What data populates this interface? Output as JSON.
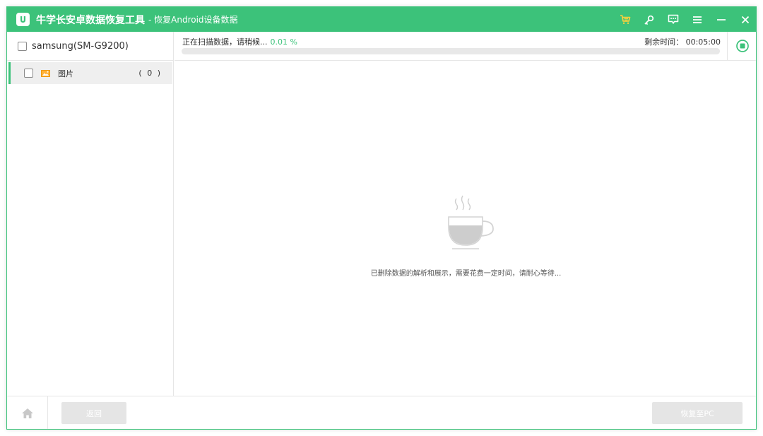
{
  "app": {
    "title": "牛学长安卓数据恢复工具",
    "subtitle": "- 恢复Android设备数据",
    "accent_color": "#3cc27a",
    "logo_letter": "U"
  },
  "titlebar_icons": [
    "cart-icon",
    "key-icon",
    "feedback-icon",
    "menu-icon",
    "minimize-icon",
    "close-icon"
  ],
  "device": {
    "name": "samsung(SM-G9200)"
  },
  "categories": [
    {
      "label": "图片",
      "count": "( 0 )",
      "icon": "image-icon"
    }
  ],
  "scan": {
    "status": "正在扫描数据，请稍候...",
    "percent_text": "0.01 %",
    "progress": 0.0001,
    "remaining_label": "剩余时间：",
    "remaining_time": "00:05:00"
  },
  "content": {
    "message": "已删除数据的解析和展示，需要花费一定时间，请耐心等待..."
  },
  "footer": {
    "back_label": "返回",
    "recover_label": "恢复至PC"
  }
}
